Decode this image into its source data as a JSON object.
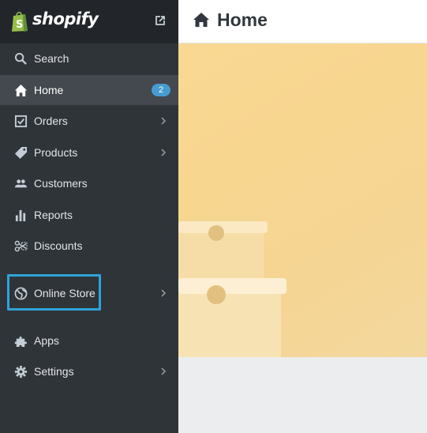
{
  "brand": {
    "name": "shopify",
    "logo_color": "#95bf47"
  },
  "colors": {
    "sidebar_bg": "#2f3439",
    "sidebar_header_bg": "#22262a",
    "active_bg": "#43494f",
    "badge_bg": "#479ccf",
    "highlight": "#2ea3d8",
    "hero": "#f7d690"
  },
  "sidebar": {
    "items": [
      {
        "label": "Search",
        "icon": "search-icon"
      },
      {
        "label": "Home",
        "icon": "home-icon",
        "badge": "2",
        "active": true
      },
      {
        "label": "Orders",
        "icon": "orders-icon",
        "chevron": true
      },
      {
        "label": "Products",
        "icon": "tag-icon",
        "chevron": true
      },
      {
        "label": "Customers",
        "icon": "customers-icon"
      },
      {
        "label": "Reports",
        "icon": "reports-icon"
      },
      {
        "label": "Discounts",
        "icon": "discounts-icon"
      },
      {
        "label": "Online Store",
        "icon": "globe-icon",
        "chevron": true,
        "highlighted": true
      },
      {
        "label": "Apps",
        "icon": "apps-icon"
      },
      {
        "label": "Settings",
        "icon": "gear-icon",
        "chevron": true
      }
    ]
  },
  "header": {
    "title": "Home"
  }
}
